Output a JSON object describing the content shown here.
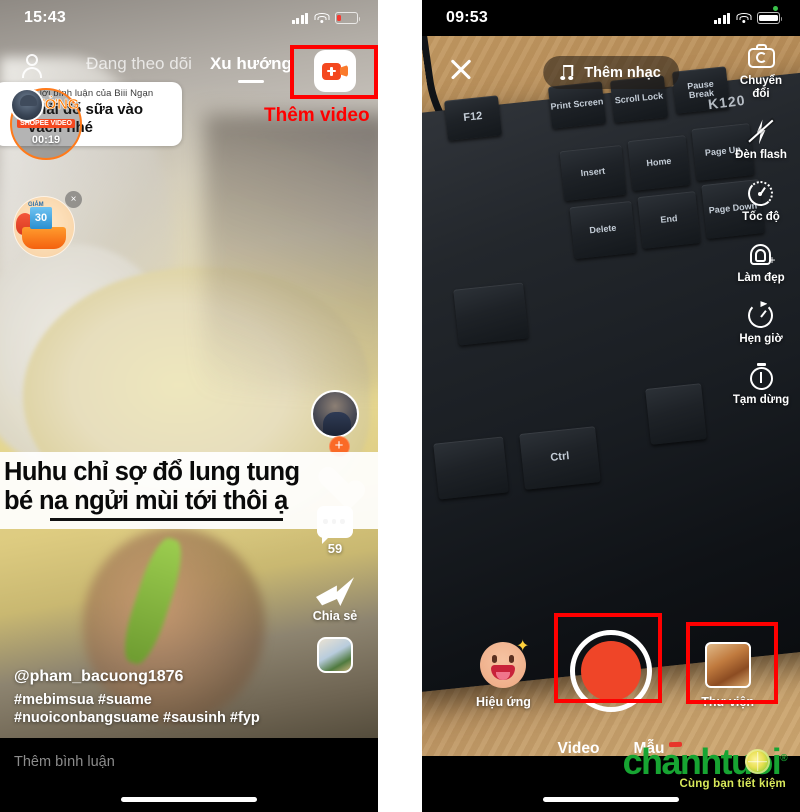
{
  "left_phone": {
    "status": {
      "time": "15:43",
      "signal": "signal-bars",
      "wifi": "wifi-icon",
      "battery": "battery-low"
    },
    "nav": {
      "profile_icon": "person-icon",
      "tabs": [
        {
          "label": "Đang theo dõi",
          "active": false
        },
        {
          "label": "Xu hướng",
          "active": true
        }
      ]
    },
    "add_video": {
      "icon": "add-video-camcorder-icon",
      "annotation": "Thêm video"
    },
    "reply_bubble": {
      "header": "Trả lời bình luận của Biii Ngạn",
      "text": "phải đổ sữa vào vách nhé"
    },
    "shopee_badge": {
      "title": "THƯỞNG",
      "subtitle": "SHOPEE VIDEO",
      "timer": "00:19"
    },
    "promo": {
      "discount_label": "GIẢM",
      "discount_value": "30",
      "close": "×"
    },
    "subtitle_lines": [
      "Huhu chỉ sợ đổ lung tung",
      "bé na ngửi mùi tới thôi ạ"
    ],
    "rail": {
      "avatar": "creator-avatar",
      "follow_plus": "+",
      "items": [
        {
          "icon": "heart-icon",
          "value": ""
        },
        {
          "icon": "comment-icon",
          "value": "59"
        },
        {
          "icon": "share-icon",
          "value": "Chia sẻ"
        }
      ],
      "music_disc": "music-album-icon"
    },
    "caption": {
      "username": "@pham_bacuong1876",
      "hashtags_line1": "#mebimsua #suame",
      "hashtags_line2": "#nuoiconbangsuame #sausinh #fyp"
    },
    "comment_bar": {
      "placeholder": "Thêm bình luận"
    }
  },
  "right_phone": {
    "status": {
      "time": "09:53",
      "signal": "signal-bars",
      "wifi": "wifi-icon",
      "battery": "battery-full"
    },
    "close_label": "close-icon",
    "music_pill": {
      "icon": "music-note-icon",
      "label": "Thêm nhạc"
    },
    "camera_rail": [
      {
        "icon": "flip-camera-icon",
        "label": "Chuyển đổi"
      },
      {
        "icon": "flash-off-icon",
        "label": "Đèn flash"
      },
      {
        "icon": "speed-icon",
        "label": "Tốc độ"
      },
      {
        "icon": "beauty-icon",
        "label": "Làm đẹp"
      },
      {
        "icon": "timer-icon",
        "label": "Hẹn giờ"
      },
      {
        "icon": "pause-icon",
        "label": "Tạm dừng"
      }
    ],
    "bottom_controls": {
      "effects": {
        "icon": "smiley-effects-icon",
        "label": "Hiệu ứng"
      },
      "record": {
        "icon": "record-button",
        "label": ""
      },
      "library": {
        "icon": "gallery-thumbnail",
        "label": "Thư viện"
      }
    },
    "tabs": [
      {
        "label": "Video",
        "active": true
      },
      {
        "label": "Mẫu",
        "active": false
      }
    ],
    "keyboard_keys": [
      "F12",
      "Print Screen",
      "Scroll Lock",
      "Pause Break",
      "Insert",
      "Home",
      "Page Up",
      "Delete",
      "End",
      "Page Down",
      "Ctrl",
      "K120"
    ],
    "watermark": {
      "brand": "chanhtuoi",
      "registered": "®",
      "tagline": "Cùng bạn tiết kiệm"
    }
  },
  "colors": {
    "annotation_red": "#ff0000",
    "record_red": "#ef4528",
    "shopee_orange": "#ff7a00",
    "brand_green": "#17a432",
    "tagline_yellow": "#d8e85a"
  }
}
